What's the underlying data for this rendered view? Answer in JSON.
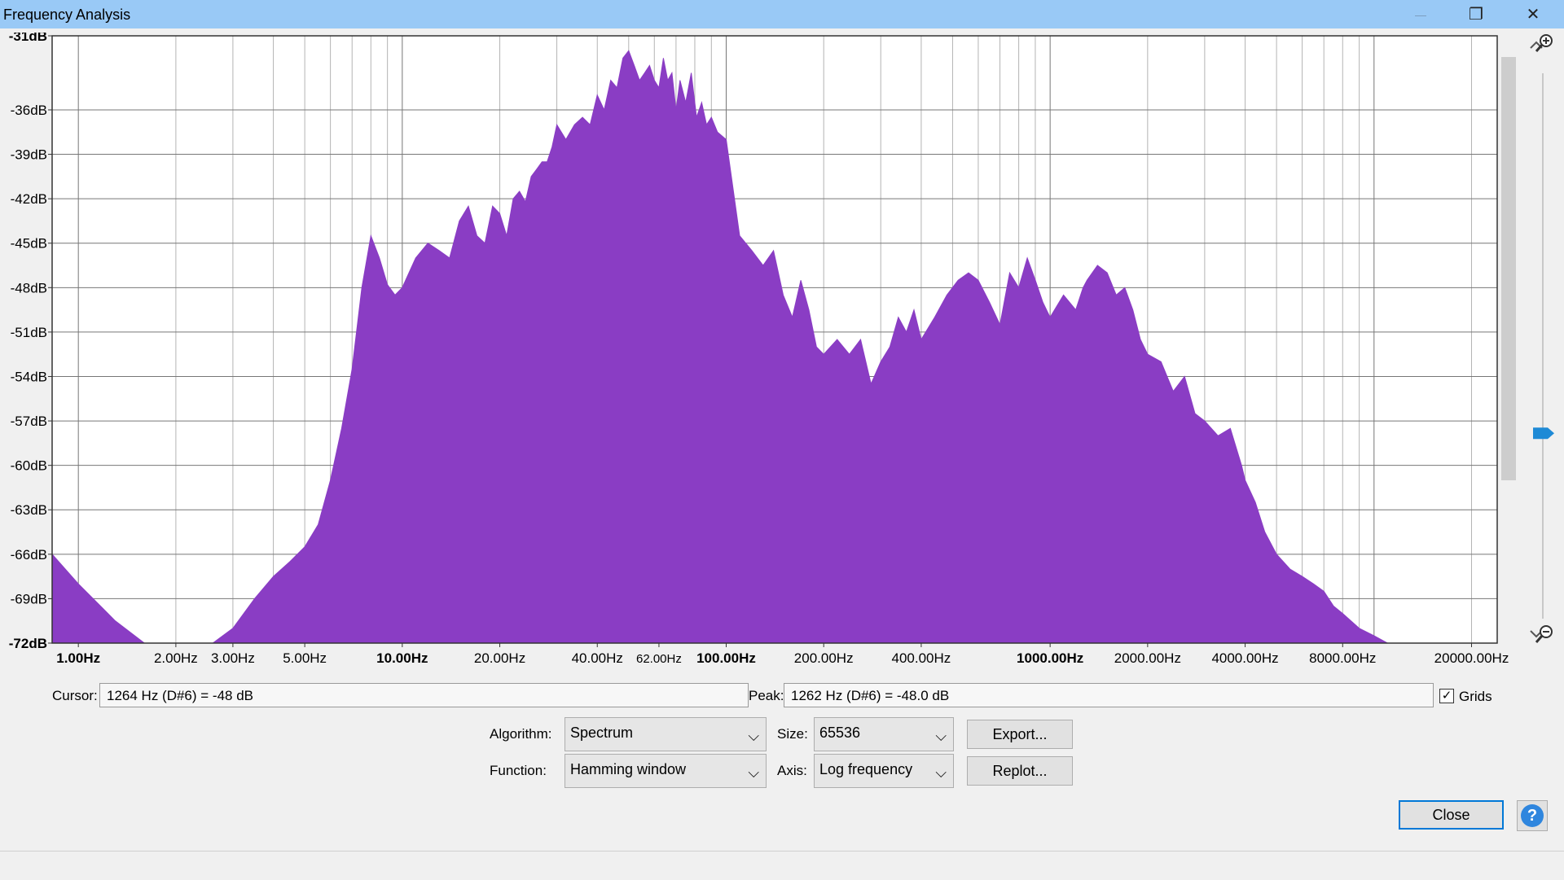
{
  "window": {
    "title": "Frequency Analysis",
    "minimize_glyph": "—",
    "restore_glyph": "❐",
    "close_glyph": "✕"
  },
  "colors": {
    "spectrum_fill": "#8a3dc4",
    "plot_background": "#ffffff",
    "grid_major": "#777777",
    "grid_minor": "#b4b4b4",
    "titlebar": "#99c9f6"
  },
  "chart_data": {
    "type": "area",
    "x_scale": "log",
    "xlim": [
      0.83,
      24000
    ],
    "ylim": [
      -72,
      -31
    ],
    "yticks": [
      {
        "value": -31,
        "label": "-31dB",
        "bold": true
      },
      {
        "value": -36,
        "label": "-36dB",
        "bold": false
      },
      {
        "value": -39,
        "label": "-39dB",
        "bold": false
      },
      {
        "value": -42,
        "label": "-42dB",
        "bold": false
      },
      {
        "value": -45,
        "label": "-45dB",
        "bold": false
      },
      {
        "value": -48,
        "label": "-48dB",
        "bold": false
      },
      {
        "value": -51,
        "label": "-51dB",
        "bold": false
      },
      {
        "value": -54,
        "label": "-54dB",
        "bold": false
      },
      {
        "value": -57,
        "label": "-57dB",
        "bold": false
      },
      {
        "value": -60,
        "label": "-60dB",
        "bold": false
      },
      {
        "value": -63,
        "label": "-63dB",
        "bold": false
      },
      {
        "value": -66,
        "label": "-66dB",
        "bold": false
      },
      {
        "value": -69,
        "label": "-69dB",
        "bold": false
      },
      {
        "value": -72,
        "label": "-72dB",
        "bold": true
      }
    ],
    "xticks": [
      {
        "value": 1,
        "label": "1.00Hz",
        "bold": true
      },
      {
        "value": 2,
        "label": "2.00Hz",
        "bold": false
      },
      {
        "value": 3,
        "label": "3.00Hz",
        "bold": false
      },
      {
        "value": 5,
        "label": "5.00Hz",
        "bold": false
      },
      {
        "value": 10,
        "label": "10.00Hz",
        "bold": true
      },
      {
        "value": 20,
        "label": "20.00Hz",
        "bold": false
      },
      {
        "value": 40,
        "label": "40.00Hz",
        "bold": false
      },
      {
        "value": 62,
        "label": "62.00Hz",
        "bold": false
      },
      {
        "value": 100,
        "label": "100.00Hz",
        "bold": true
      },
      {
        "value": 200,
        "label": "200.00Hz",
        "bold": false
      },
      {
        "value": 400,
        "label": "400.00Hz",
        "bold": false
      },
      {
        "value": 1000,
        "label": "1000.00Hz",
        "bold": true
      },
      {
        "value": 2000,
        "label": "2000.00Hz",
        "bold": false
      },
      {
        "value": 4000,
        "label": "4000.00Hz",
        "bold": false
      },
      {
        "value": 8000,
        "label": "8000.00Hz",
        "bold": false
      },
      {
        "value": 20000,
        "label": "20000.00Hz",
        "bold": false
      }
    ],
    "x": [
      0.83,
      1.0,
      1.3,
      1.6,
      2.0,
      2.4,
      2.6,
      3.0,
      3.5,
      4.0,
      4.5,
      5.0,
      5.5,
      6.0,
      6.5,
      7.0,
      7.5,
      8.0,
      8.5,
      9.0,
      9.5,
      10.0,
      11,
      12,
      13,
      14,
      15,
      16,
      17,
      18,
      19,
      20,
      21,
      22,
      23,
      24,
      25,
      26,
      27,
      28,
      29,
      30,
      32,
      34,
      36,
      38,
      40,
      42,
      44,
      46,
      48,
      50,
      52,
      54,
      56,
      58,
      60,
      62,
      64,
      66,
      68,
      70,
      72,
      75,
      78,
      81,
      84,
      87,
      90,
      94,
      100,
      110,
      120,
      130,
      140,
      150,
      160,
      170,
      180,
      190,
      200,
      220,
      240,
      260,
      280,
      300,
      320,
      340,
      360,
      380,
      400,
      440,
      480,
      520,
      560,
      600,
      650,
      700,
      750,
      800,
      850,
      900,
      950,
      1000,
      1100,
      1200,
      1264,
      1300,
      1400,
      1500,
      1600,
      1700,
      1800,
      1900,
      2000,
      2200,
      2400,
      2600,
      2800,
      3000,
      3300,
      3600,
      3900,
      4000,
      4300,
      4600,
      5000,
      5500,
      6000,
      6500,
      7000,
      7500,
      8000,
      9000,
      10000,
      11000,
      12000,
      13000,
      14000,
      15000
    ],
    "y": [
      -66,
      -68,
      -70.5,
      -72,
      -72,
      -72,
      -72,
      -71,
      -69,
      -67.5,
      -66.5,
      -65.5,
      -64,
      -61,
      -57.5,
      -53.5,
      -48,
      -44.5,
      -46,
      -47.8,
      -48.5,
      -48,
      -46,
      -45,
      -45.5,
      -46,
      -43.5,
      -42.5,
      -44.5,
      -45,
      -42.5,
      -43,
      -44.5,
      -42,
      -41.5,
      -42.2,
      -40.5,
      -40,
      -39.5,
      -39.5,
      -38.5,
      -37,
      -38,
      -37,
      -36.5,
      -37,
      -35,
      -36,
      -34,
      -34.5,
      -32.5,
      -32,
      -33,
      -34,
      -33.5,
      -33,
      -34,
      -34.5,
      -32.5,
      -34,
      -33.5,
      -36,
      -34,
      -35.5,
      -33.5,
      -36.5,
      -35.5,
      -37,
      -36.5,
      -37.5,
      -38,
      -44.5,
      -45.5,
      -46.5,
      -45.5,
      -48.5,
      -50,
      -47.5,
      -49.5,
      -52,
      -52.5,
      -51.5,
      -52.5,
      -51.5,
      -54.5,
      -53,
      -52,
      -50,
      -51,
      -49.5,
      -51.5,
      -50,
      -48.5,
      -47.5,
      -47,
      -47.5,
      -49,
      -50.5,
      -47,
      -48,
      -46,
      -47.5,
      -49,
      -50,
      -48.5,
      -49.5,
      -48,
      -47.5,
      -46.5,
      -47,
      -48.5,
      -48,
      -49.5,
      -51.5,
      -52.5,
      -53,
      -55,
      -54,
      -56.5,
      -57,
      -58,
      -57.5,
      -60,
      -61,
      -62.5,
      -64.5,
      -66,
      -67,
      -67.5,
      -68,
      -68.5,
      -69.5,
      -70,
      -71,
      -71.5,
      -72
    ]
  },
  "cursor": {
    "label": "Cursor:",
    "value": "1264 Hz (D#6) = -48 dB"
  },
  "peak": {
    "label": "Peak:",
    "value": "1262 Hz (D#6) = -48.0 dB"
  },
  "grids": {
    "label": "Grids",
    "checked": true,
    "check_glyph": "✓"
  },
  "algorithm": {
    "label": "Algorithm:",
    "value": "Spectrum"
  },
  "size": {
    "label": "Size:",
    "value": "65536"
  },
  "function": {
    "label": "Function:",
    "value": "Hamming window"
  },
  "axis": {
    "label": "Axis:",
    "value": "Log frequency"
  },
  "buttons": {
    "export": "Export...",
    "replot": "Replot...",
    "close": "Close",
    "help_glyph": "?"
  },
  "combo_arrow": "⌵",
  "icons": {
    "zoom_in": "zoom-in-icon",
    "zoom_out": "zoom-out-icon",
    "scroll_up": "chevron-up-icon",
    "scroll_down": "chevron-down-icon",
    "slider_thumb": "slider-thumb-icon"
  },
  "zoom_slider": {
    "level": 0.66
  }
}
